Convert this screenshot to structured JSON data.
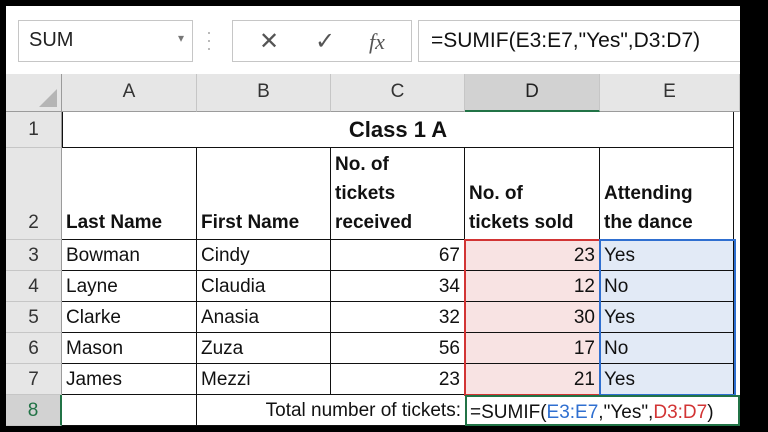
{
  "formula_bar": {
    "name_box": "SUM",
    "cancel_icon": "close-icon",
    "enter_icon": "check-icon",
    "fx_label": "fx",
    "formula": "=SUMIF(E3:E7,\"Yes\",D3:D7)"
  },
  "columns": [
    "A",
    "B",
    "C",
    "D",
    "E"
  ],
  "rows": [
    "1",
    "2",
    "3",
    "4",
    "5",
    "6",
    "7",
    "8"
  ],
  "sheet": {
    "title": "Class 1 A",
    "headers": {
      "last_name": "Last Name",
      "first_name": "First Name",
      "received_1": "No. of",
      "received_2": "tickets",
      "received_3": "received",
      "sold_1": "No. of",
      "sold_2": "tickets sold",
      "attending_1": "Attending",
      "attending_2": "the dance"
    },
    "data_rows": [
      {
        "last": "Bowman",
        "first": "Cindy",
        "received": "67",
        "sold": "23",
        "attending": "Yes"
      },
      {
        "last": "Layne",
        "first": "Claudia",
        "received": "34",
        "sold": "12",
        "attending": "No"
      },
      {
        "last": "Clarke",
        "first": "Anasia",
        "received": "32",
        "sold": "30",
        "attending": "Yes"
      },
      {
        "last": "Mason",
        "first": "Zuza",
        "received": "56",
        "sold": "17",
        "attending": "No"
      },
      {
        "last": "James",
        "first": "Mezzi",
        "received": "23",
        "sold": "21",
        "attending": "Yes"
      }
    ],
    "total_label": "Total number of tickets:",
    "edit_formula": {
      "prefix": "=SUMIF(",
      "range_e": "E3:E7",
      "middle": ",\"Yes\",",
      "range_d": "D3:D7",
      "suffix": ")"
    }
  },
  "colors": {
    "excel_green": "#217346",
    "ref_blue": "#2f6fd0",
    "ref_red": "#d23434",
    "d_fill": "#f8e3e3",
    "e_fill": "#e2eaf6"
  }
}
